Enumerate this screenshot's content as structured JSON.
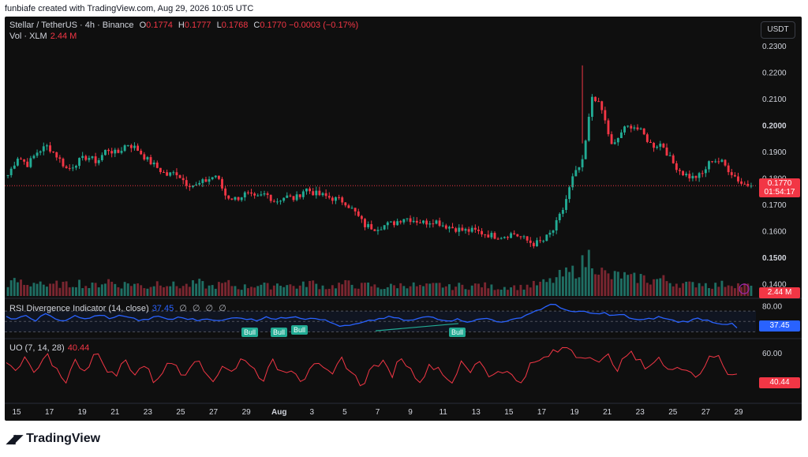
{
  "caption": "funbiafe created with TradingView.com, Aug 29, 2026 10:05 UTC",
  "currency_button": "USDT",
  "brand": "TradingView",
  "main_legend": {
    "symbol": "Stellar / TetherUS · 4h · Binance",
    "o_label": "O",
    "o": "0.1774",
    "h_label": "H",
    "h": "0.1777",
    "l_label": "L",
    "l": "0.1768",
    "c_label": "C",
    "c": "0.1770",
    "change": "−0.0003 (−0.17%)",
    "vol_label": "Vol · XLM",
    "vol": "2.44 M"
  },
  "rsi_legend": {
    "name": "RSI Divergence Indicator (14, close)",
    "value": "37.45",
    "icons": "∅ ∅ ∅ ∅"
  },
  "uo_legend": {
    "name": "UO (7, 14, 28)",
    "value": "40.44"
  },
  "price_axis": [
    "0.2300",
    "0.2200",
    "0.2100",
    "0.2000",
    "0.1900",
    "0.1800",
    "0.1700",
    "0.1600",
    "0.1500",
    "0.1400"
  ],
  "price_tag": {
    "value": "0.1770",
    "countdown": "01:54:17"
  },
  "volume_tag": "2.44 M",
  "rsi_axis": "80.00",
  "rsi_tag": "37.45",
  "uo_axis": "60.00",
  "uo_tag": "40.44",
  "time_axis": [
    "15",
    "17",
    "19",
    "21",
    "23",
    "25",
    "27",
    "29",
    "Aug",
    "3",
    "5",
    "7",
    "9",
    "11",
    "13",
    "15",
    "17",
    "19",
    "21",
    "23",
    "25",
    "27",
    "29"
  ],
  "bull_labels": [
    "Bull",
    "Bull",
    "Bull",
    "Bull"
  ],
  "colors": {
    "up": "#22ab94",
    "down": "#f23645",
    "rsi": "#2962ff",
    "uo": "#f23645",
    "background": "#0f0f0f"
  },
  "chart_data": [
    {
      "type": "candlestick",
      "title": "Stellar / TetherUS · 4h · Binance",
      "x": [
        "15",
        "17",
        "19",
        "21",
        "23",
        "25",
        "27",
        "29",
        "Aug",
        "3",
        "5",
        "7",
        "9",
        "11",
        "13",
        "15",
        "17",
        "19",
        "21",
        "23",
        "25",
        "27",
        "29"
      ],
      "ylim": [
        0.135,
        0.235
      ],
      "close_path": [
        0.181,
        0.188,
        0.185,
        0.19,
        0.192,
        0.188,
        0.183,
        0.186,
        0.188,
        0.186,
        0.191,
        0.189,
        0.193,
        0.191,
        0.187,
        0.184,
        0.181,
        0.182,
        0.178,
        0.177,
        0.179,
        0.181,
        0.173,
        0.172,
        0.174,
        0.172,
        0.174,
        0.171,
        0.173,
        0.172,
        0.176,
        0.174,
        0.173,
        0.172,
        0.171,
        0.167,
        0.162,
        0.161,
        0.162,
        0.163,
        0.165,
        0.164,
        0.163,
        0.164,
        0.162,
        0.161,
        0.16,
        0.16,
        0.159,
        0.158,
        0.158,
        0.159,
        0.157,
        0.155,
        0.156,
        0.16,
        0.168,
        0.18,
        0.186,
        0.212,
        0.205,
        0.191,
        0.198,
        0.2,
        0.197,
        0.192,
        0.193,
        0.186,
        0.182,
        0.18,
        0.181,
        0.187,
        0.186,
        0.182,
        0.178,
        0.177
      ],
      "last_close": 0.177
    },
    {
      "type": "bar",
      "title": "Vol · XLM",
      "last_value": "2.44 M",
      "ylim": [
        0,
        1
      ],
      "values": [
        0.3,
        0.36,
        0.24,
        0.4,
        0.21,
        0.3,
        0.26,
        0.34,
        0.22,
        0.29,
        0.38,
        0.25,
        0.31,
        0.27,
        0.21,
        0.35,
        0.29,
        0.24,
        0.26,
        0.32,
        0.22,
        0.27,
        0.3,
        0.2,
        0.24,
        0.28,
        0.23,
        0.31,
        0.26,
        0.22,
        0.34,
        0.25,
        0.21,
        0.28,
        0.3,
        0.24,
        0.27,
        0.2,
        0.23,
        0.26,
        0.29,
        0.22,
        0.24,
        0.27,
        0.21,
        0.25,
        0.23,
        0.28,
        0.22,
        0.2,
        0.24,
        0.21,
        0.26,
        0.3,
        0.35,
        0.48,
        0.56,
        0.7,
        1.0,
        0.6,
        0.45,
        0.52,
        0.41,
        0.46,
        0.37,
        0.42,
        0.34,
        0.3,
        0.27,
        0.33,
        0.25,
        0.28,
        0.31,
        0.26,
        0.24
      ]
    },
    {
      "type": "line",
      "title": "RSI Divergence Indicator (14, close)",
      "ylim": [
        20,
        90
      ],
      "values": [
        58,
        55,
        60,
        52,
        64,
        57,
        50,
        61,
        54,
        59,
        62,
        55,
        63,
        57,
        51,
        56,
        60,
        53,
        58,
        55,
        52,
        57,
        50,
        54,
        59,
        55,
        52,
        60,
        54,
        57,
        61,
        55,
        58,
        53,
        46,
        40,
        43,
        47,
        52,
        56,
        59,
        54,
        51,
        56,
        60,
        55,
        52,
        54,
        50,
        53,
        56,
        51,
        49,
        55,
        62,
        70,
        77,
        84,
        74,
        66,
        71,
        63,
        68,
        60,
        64,
        56,
        52,
        55,
        59,
        53,
        49,
        51,
        56,
        52,
        47,
        45,
        44
      ],
      "last_value": 37.45,
      "divergence": [
        "Bull",
        "Bull",
        "Bull",
        "Bull"
      ]
    },
    {
      "type": "line",
      "title": "UO (7, 14, 28)",
      "ylim": [
        15,
        70
      ],
      "values": [
        50,
        42,
        55,
        38,
        58,
        46,
        34,
        52,
        44,
        60,
        48,
        37,
        54,
        41,
        49,
        33,
        46,
        52,
        39,
        56,
        43,
        35,
        50,
        40,
        58,
        45,
        36,
        51,
        42,
        47,
        33,
        53,
        44,
        38,
        55,
        41,
        30,
        46,
        52,
        39,
        57,
        43,
        35,
        49,
        45,
        31,
        50,
        42,
        54,
        37,
        46,
        40,
        32,
        48,
        52,
        58,
        62,
        66,
        55,
        60,
        49,
        57,
        45,
        61,
        52,
        47,
        56,
        42,
        50,
        44,
        38,
        53,
        58,
        42,
        40
      ],
      "last_value": 40.44
    }
  ]
}
